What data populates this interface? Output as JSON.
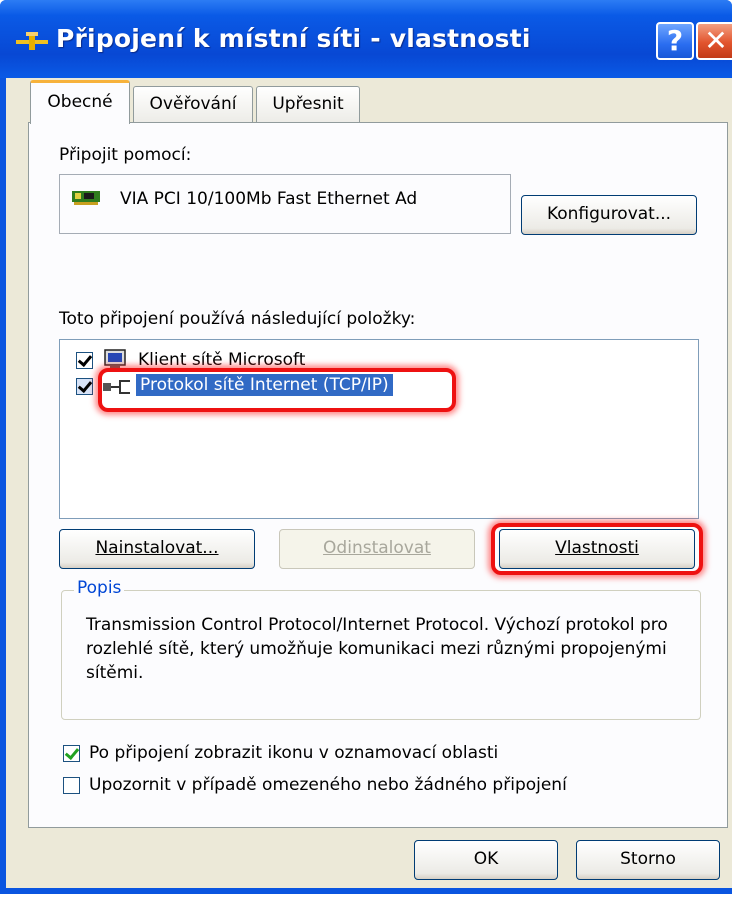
{
  "window": {
    "title": "Připojení k místní síti - vlastnosti",
    "help_glyph": "?",
    "close_glyph": "✕"
  },
  "tabs": [
    {
      "label": "Obecné",
      "active": true
    },
    {
      "label": "Ověřování",
      "active": false
    },
    {
      "label": "Upřesnit",
      "active": false
    }
  ],
  "general": {
    "connect_using_label": "Připojit pomocí:",
    "adapter_name": "VIA PCI 10/100Mb Fast Ethernet Ad",
    "configure_button": "Konfigurovat...",
    "items_label": "Toto připojení používá následující položky:",
    "items": [
      {
        "label": "Klient sítě Microsoft",
        "checked": true,
        "selected": false,
        "icon": "network-client-icon"
      },
      {
        "label": "Protokol sítě Internet (TCP/IP)",
        "checked": true,
        "selected": true,
        "icon": "network-protocol-icon"
      }
    ],
    "install_button": "Nainstalovat...",
    "uninstall_button": "Odinstalovat",
    "properties_button": "Vlastnosti",
    "description_legend": "Popis",
    "description_text": "Transmission Control Protocol/Internet Protocol. Výchozí protokol pro rozlehlé sítě, který umožňuje komunikaci mezi různými propojenými sítěmi.",
    "show_icon_label": "Po připojení zobrazit ikonu v oznamovací oblasti",
    "show_icon_checked": true,
    "notify_label": "Upozornit v případě omezeného nebo žádného připojení",
    "notify_checked": false
  },
  "footer": {
    "ok_button": "OK",
    "cancel_button": "Storno"
  },
  "colors": {
    "titlebar": "#0a55e0",
    "selection": "#316ac5",
    "highlight_ring": "#ee1111",
    "group_legend": "#0046d5"
  }
}
